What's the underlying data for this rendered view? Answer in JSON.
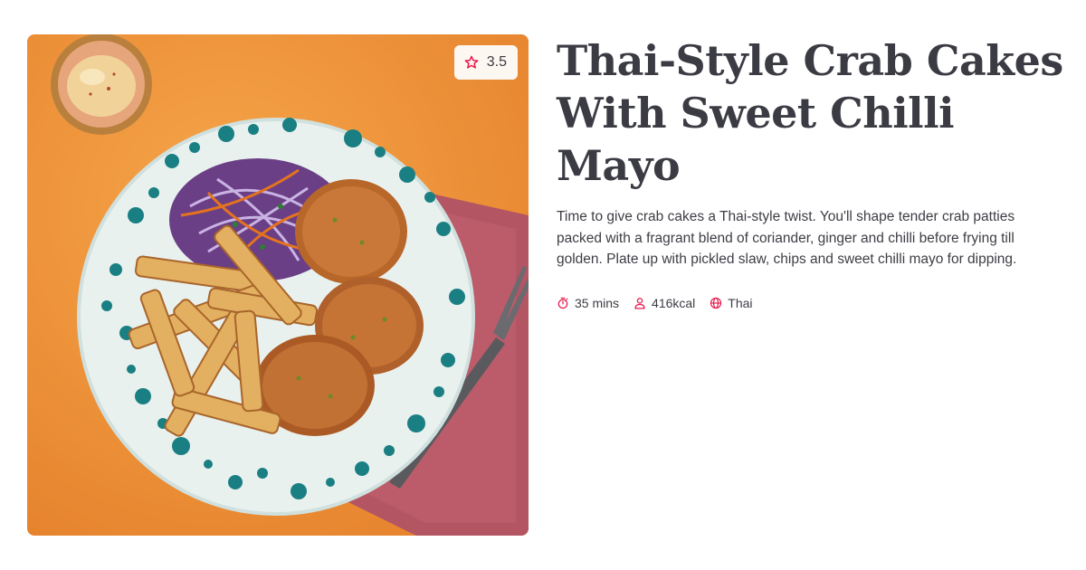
{
  "recipe": {
    "rating": "3.5",
    "title_line1": "Thai-Style Crab Cakes",
    "title_line2": "With Sweet Chilli Mayo",
    "description": "Time to give crab cakes a Thai-style twist. You'll shape tender crab patties packed with a fragrant blend of coriander, ginger and chilli before frying till golden. Plate up with pickled slaw, chips and sweet chilli mayo for dipping.",
    "meta": {
      "time": "35 mins",
      "calories": "416kcal",
      "cuisine": "Thai"
    }
  },
  "icons": {
    "rating": "star-outline-icon",
    "time": "stopwatch-icon",
    "calories": "person-icon",
    "cuisine": "globe-icon"
  },
  "colors": {
    "accent": "#e8194b",
    "title": "#3b3b44",
    "text": "#3d3d45",
    "badge_bg": "#fdf7f2",
    "photo_background": "#f0993e"
  }
}
